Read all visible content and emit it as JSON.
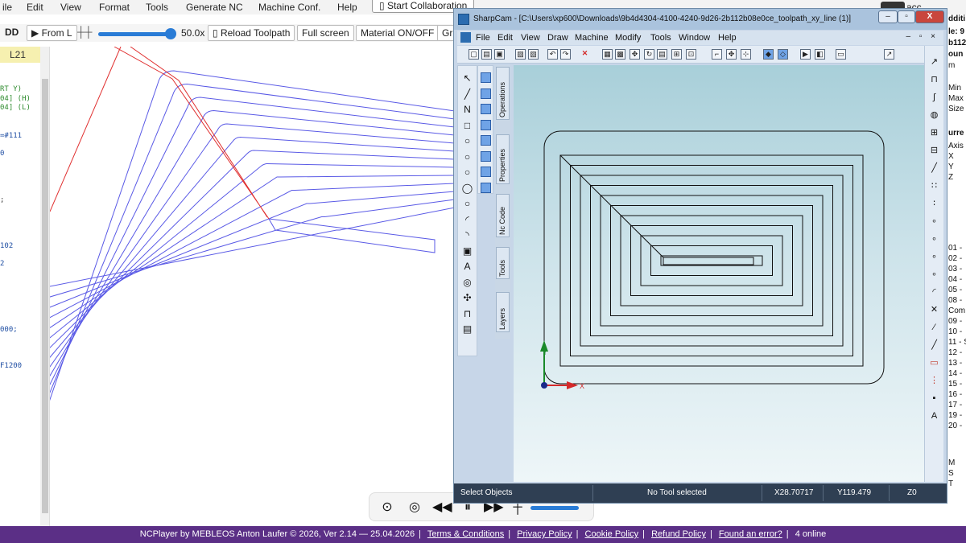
{
  "menubar": {
    "items": [
      "ile",
      "Edit",
      "View",
      "Format",
      "Tools",
      "Generate NC",
      "Machine Conf.",
      "Help"
    ],
    "collab_label": "Start Collaboration",
    "collab_icon": "collab-icon",
    "account_text": "acc"
  },
  "toolbar": {
    "ff_label": "DD",
    "from_label": "From L",
    "from_icon": "play-icon",
    "speed": "50.0x",
    "speed_level_percent": 92,
    "reload_label": "Reload Toolpath",
    "fullscreen_label": "Full screen",
    "material_label": "Material ON/OFF",
    "cut_label": "Gr"
  },
  "code": {
    "line_indicator": "L21",
    "lines": [
      {
        "text": "RT Y)",
        "color": "#2e8b2e"
      },
      {
        "text": "04] (H)",
        "color": "#2e8b2e"
      },
      {
        "text": "04]  (L)",
        "color": "#2e8b2e"
      },
      {
        "text": "=#111",
        "color": "#1f4ea3"
      },
      {
        "text": "0",
        "color": "#1f4ea3"
      },
      {
        "text": ";",
        "color": "#333333"
      },
      {
        "text": "102",
        "color": "#1f4ea3"
      },
      {
        "text": "2",
        "color": "#1f4ea3"
      },
      {
        "text": "000;",
        "color": "#1f4ea3"
      },
      {
        "text": "F1200",
        "color": "#1f4ea3"
      }
    ]
  },
  "player": {
    "icons": [
      "play-circle-icon",
      "stop-circle-icon",
      "rewind-icon",
      "pause-icon",
      "fast-forward-icon",
      "equalizer-icon"
    ]
  },
  "footer": {
    "credit": "NCPlayer by MEBLEOS Anton Laufer © 2026, Ver 2.14 — 25.04.2026",
    "links": [
      "Terms & Conditions",
      "Privacy Policy",
      "Cookie Policy",
      "Refund Policy",
      "Found an error?"
    ],
    "online": "4 online"
  },
  "right_bg": {
    "lines": [
      "dditi",
      "le: 9",
      "b112",
      "oun",
      "m",
      "Min",
      "Max",
      "Size",
      "urre",
      "Axis",
      "X",
      "Y",
      "Z",
      "01 -",
      "02 -",
      "03 -",
      "04 -",
      "05 -",
      "08 -",
      "Com",
      "09 -",
      "10 -",
      "11 - S",
      "12 -",
      "13 -",
      "14 -",
      "15 -",
      "16 -",
      "17 -",
      "19 -",
      "20 -",
      "M",
      "S",
      "T"
    ]
  },
  "sharpcam": {
    "title": "SharpCam - [C:\\Users\\xp600\\Downloads\\9b4d4304-4100-4240-9d26-2b112b08e0ce_toolpath_xy_line (1)]",
    "window_buttons": [
      "minimize-icon",
      "restore-icon",
      "close-icon"
    ],
    "close_glyph": "X",
    "menus": [
      "File",
      "Edit",
      "View",
      "Draw",
      "Machine",
      "Modify",
      "Tools",
      "Window",
      "Help"
    ],
    "mdi_controls": "– ▫ ×",
    "side_tabs": [
      "Operations",
      "Properties",
      "Nc Code",
      "Tools",
      "Layers"
    ],
    "axis_x_label": "X",
    "axis_y_label": "Y",
    "status": {
      "left": "Select Objects",
      "tool": "No Tool selected",
      "x": "X28.70717",
      "y": "Y119.479",
      "z": "Z0"
    },
    "accent": "#2b6cb0",
    "status_bg": "#2f3f53"
  }
}
